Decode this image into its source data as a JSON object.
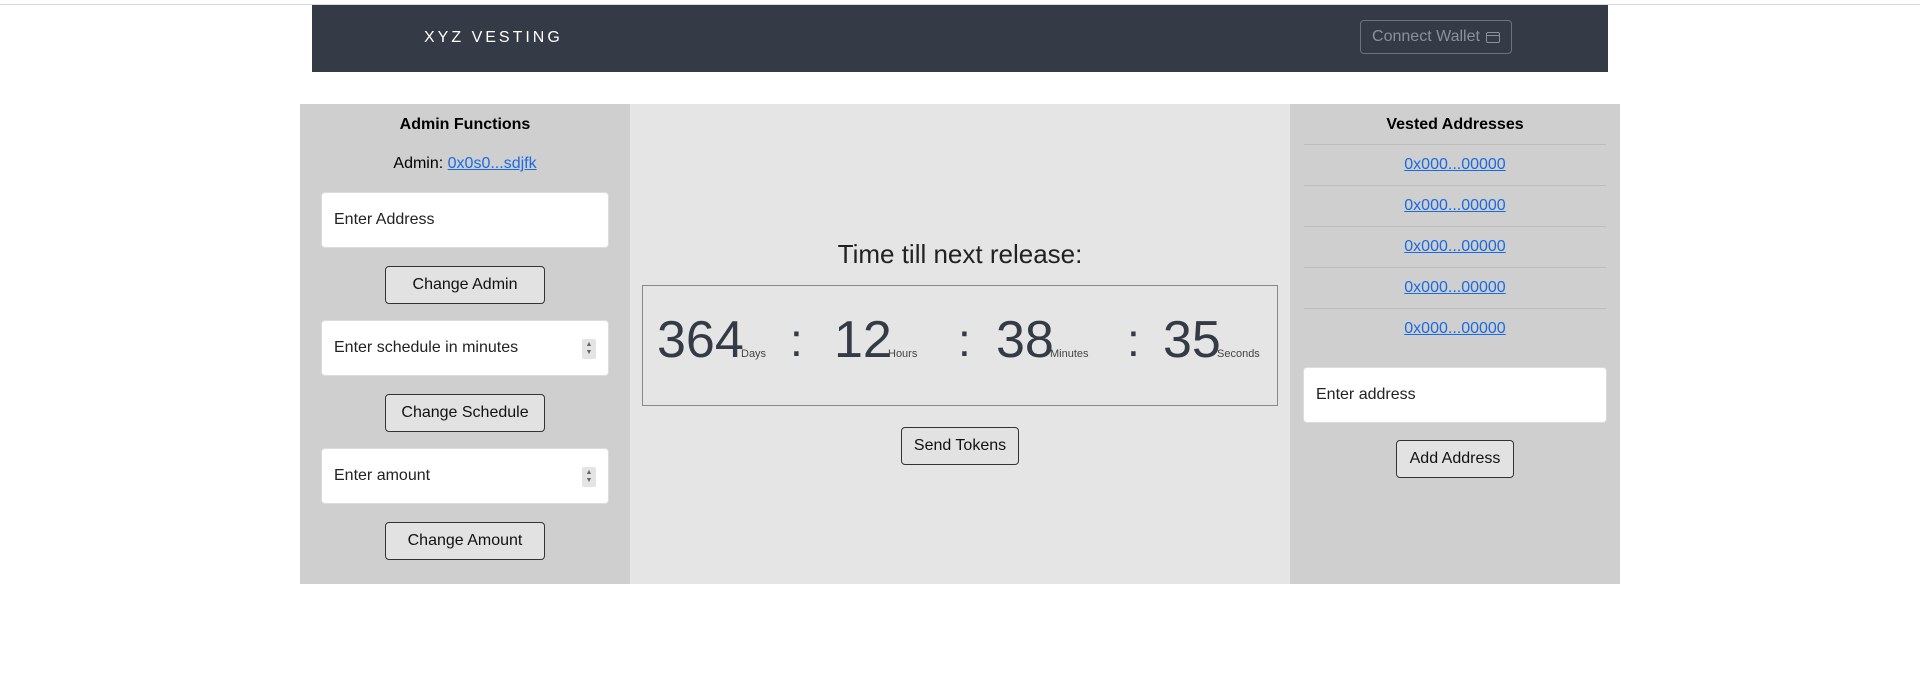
{
  "navbar": {
    "brand": "XYZ VESTING",
    "connect_wallet_label": "Connect Wallet",
    "connect_wallet_icon": "wallet-icon"
  },
  "admin_panel": {
    "title": "Admin Functions",
    "admin_label": "Admin: ",
    "admin_address": "0x0s0...sdjfk",
    "address_placeholder": "Enter Address",
    "change_admin_label": "Change Admin",
    "schedule_placeholder": "Enter schedule in minutes",
    "change_schedule_label": "Change Schedule",
    "amount_placeholder": "Enter amount",
    "change_amount_label": "Change Amount"
  },
  "timer": {
    "heading": "Time till next release:",
    "days": "364",
    "days_label": "Days",
    "hours": "12",
    "hours_label": "Hours",
    "minutes": "38",
    "minutes_label": "Minutes",
    "seconds": "35",
    "seconds_label": "Seconds",
    "separator": ":",
    "send_tokens_label": "Send Tokens"
  },
  "vested_panel": {
    "title": "Vested Addresses",
    "addresses": [
      "0x000...00000",
      "0x000...00000",
      "0x000...00000",
      "0x000...00000",
      "0x000...00000"
    ],
    "address_placeholder": "Enter address",
    "add_address_label": "Add Address"
  },
  "colors": {
    "navbar_bg": "#343a46",
    "side_panel_bg": "#cfcfcf",
    "center_panel_bg": "#e5e5e5",
    "link": "#1a6be0"
  }
}
